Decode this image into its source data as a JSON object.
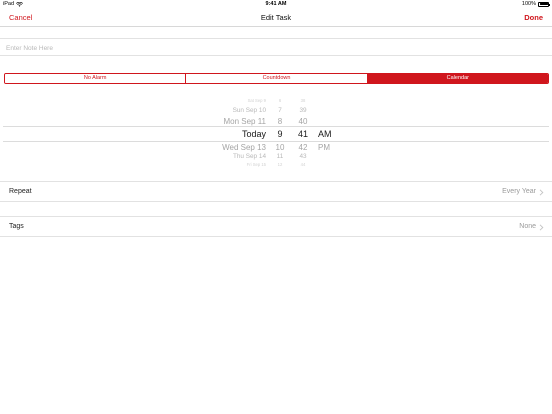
{
  "status_bar": {
    "device": "iPad",
    "time": "9:41 AM",
    "battery": "100%",
    "battery_level": 1.0,
    "icons": [
      "wifi-icon",
      "battery-icon"
    ]
  },
  "nav": {
    "cancel_label": "Cancel",
    "title": "Edit Task",
    "done_label": "Done"
  },
  "note": {
    "placeholder": "Enter Note Here",
    "value": ""
  },
  "alarm_modes": {
    "options": [
      "No Alarm",
      "Countdown",
      "Calendar"
    ],
    "selected": "Calendar"
  },
  "picker": {
    "date_column": [
      "Sat Sep 9",
      "Sun Sep 10",
      "Mon Sep 11",
      "Today",
      "Wed Sep 13",
      "Thu Sep 14",
      "Fri Sep 15"
    ],
    "hour_column": [
      "6",
      "7",
      "8",
      "9",
      "10",
      "11",
      "12"
    ],
    "minute_column": [
      "38",
      "39",
      "40",
      "41",
      "42",
      "43",
      "44"
    ],
    "ampm_column": [
      "AM",
      "PM"
    ],
    "selected": {
      "date": "Today",
      "hour": "9",
      "minute": "41",
      "ampm": "AM"
    }
  },
  "repeat": {
    "label": "Repeat",
    "value": "Every Year"
  },
  "tags": {
    "label": "Tags",
    "value": "None"
  },
  "colors": {
    "accent": "#d0161d",
    "separator": "#e2e2e2",
    "secondary_text": "#9a9a9a",
    "placeholder_text": "#b9b9b9"
  }
}
